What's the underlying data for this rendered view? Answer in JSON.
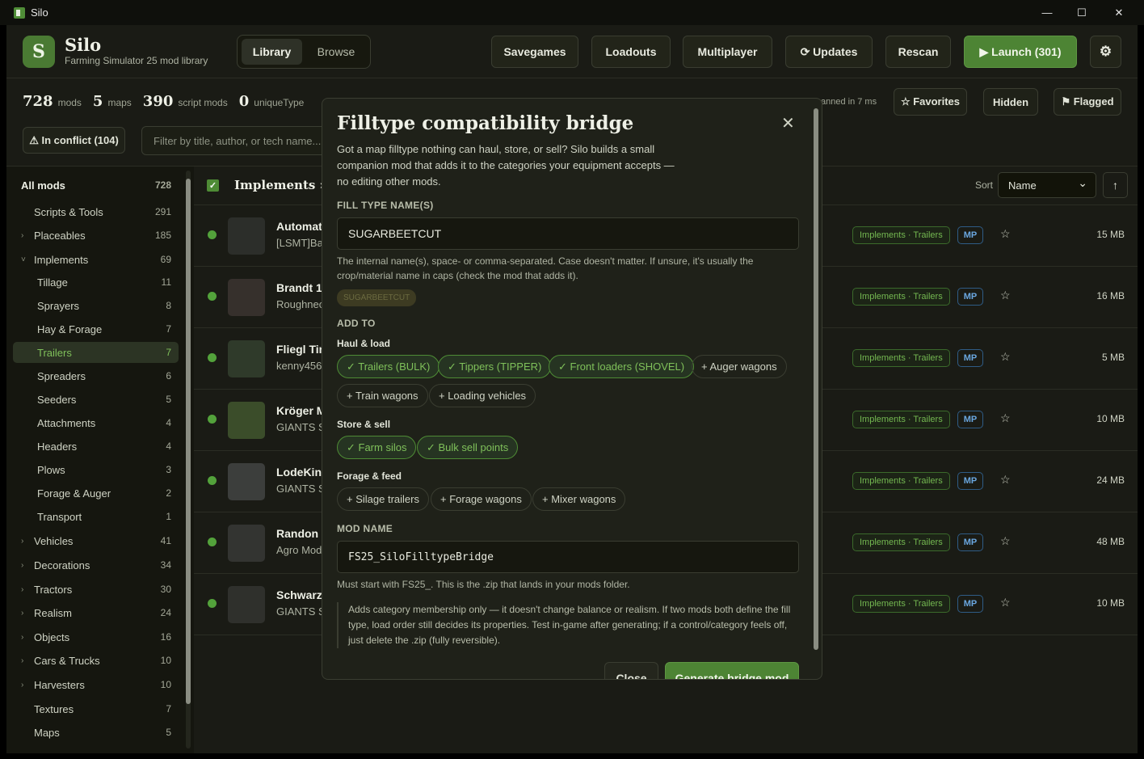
{
  "window": {
    "title": "Silo",
    "minimize": "—",
    "maximize": "☐",
    "close": "✕"
  },
  "brand": {
    "logo": "S",
    "name": "Silo",
    "tagline": "Farming Simulator 25 mod library"
  },
  "nav": {
    "library": "Library",
    "browse": "Browse"
  },
  "header_buttons": {
    "savegames": "Savegames",
    "loadouts": "Loadouts",
    "multiplayer": "Multiplayer",
    "updates": "⟳ Updates",
    "rescan": "Rescan",
    "launch": "▶ Launch (301)",
    "settings": "⚙"
  },
  "stats": {
    "mods": "728",
    "mods_label": "mods",
    "maps": "5",
    "maps_label": "maps",
    "script": "390",
    "script_label": "script mods",
    "unique": "0",
    "unique_label": "uniqueType",
    "scanned": "anned in 7 ms"
  },
  "filters": {
    "favorites": "☆ Favorites",
    "hidden": "Hidden",
    "flagged": "⚑ Flagged",
    "conflict": "⚠ In conflict (104)",
    "search_placeholder": "Filter by title, author, or tech name..."
  },
  "sidebar": {
    "all": {
      "label": "All mods",
      "count": "728"
    },
    "items": [
      {
        "label": "Scripts & Tools",
        "count": "291",
        "chev": ""
      },
      {
        "label": "Placeables",
        "count": "185",
        "chev": "›"
      },
      {
        "label": "Implements",
        "count": "69",
        "chev": "˅"
      },
      {
        "label": "Tillage",
        "count": "11",
        "chev": ""
      },
      {
        "label": "Sprayers",
        "count": "8",
        "chev": ""
      },
      {
        "label": "Hay & Forage",
        "count": "7",
        "chev": ""
      },
      {
        "label": "Trailers",
        "count": "7",
        "chev": ""
      },
      {
        "label": "Spreaders",
        "count": "6",
        "chev": ""
      },
      {
        "label": "Seeders",
        "count": "5",
        "chev": ""
      },
      {
        "label": "Attachments",
        "count": "4",
        "chev": ""
      },
      {
        "label": "Headers",
        "count": "4",
        "chev": ""
      },
      {
        "label": "Plows",
        "count": "3",
        "chev": ""
      },
      {
        "label": "Forage & Auger",
        "count": "2",
        "chev": ""
      },
      {
        "label": "Transport",
        "count": "1",
        "chev": ""
      },
      {
        "label": "Vehicles",
        "count": "41",
        "chev": "›"
      },
      {
        "label": "Decorations",
        "count": "34",
        "chev": "›"
      },
      {
        "label": "Tractors",
        "count": "30",
        "chev": "›"
      },
      {
        "label": "Realism",
        "count": "24",
        "chev": "›"
      },
      {
        "label": "Objects",
        "count": "16",
        "chev": "›"
      },
      {
        "label": "Cars & Trucks",
        "count": "10",
        "chev": "›"
      },
      {
        "label": "Harvesters",
        "count": "10",
        "chev": "›"
      },
      {
        "label": "Textures",
        "count": "7",
        "chev": ""
      },
      {
        "label": "Maps",
        "count": "5",
        "chev": ""
      }
    ]
  },
  "list": {
    "check": "✓",
    "breadcrumb": "Implements › T",
    "sort_label": "Sort",
    "sort_value": "Name",
    "sort_dir": "↑",
    "rows": [
      {
        "name": "Automat",
        "author": "[LSMT]BaT",
        "tag": "Implements · Trailers",
        "mp": "MP",
        "star": "☆",
        "size": "15 MB"
      },
      {
        "name": "Brandt 11",
        "author": "Roughnec",
        "tag": "Implements · Trailers",
        "mp": "MP",
        "star": "☆",
        "size": "16 MB"
      },
      {
        "name": "Fliegl Tin",
        "author": "kenny456,",
        "tag": "Implements · Trailers",
        "mp": "MP",
        "star": "☆",
        "size": "5 MB"
      },
      {
        "name": "Kröger M",
        "author": "GIANTS Sc",
        "tag": "Implements · Trailers",
        "mp": "MP",
        "star": "☆",
        "size": "10 MB"
      },
      {
        "name": "LodeKing",
        "author": "GIANTS Sc",
        "tag": "Implements · Trailers",
        "mp": "MP",
        "star": "☆",
        "size": "24 MB"
      },
      {
        "name": "Randon I",
        "author": "Agro Mod",
        "tag": "Implements · Trailers",
        "mp": "MP",
        "star": "☆",
        "size": "48 MB"
      },
      {
        "name": "Schwarzr",
        "author": "GIANTS Sc",
        "tag": "Implements · Trailers",
        "mp": "MP",
        "star": "☆",
        "size": "10 MB"
      }
    ]
  },
  "modal": {
    "title": "Filltype compatibility bridge",
    "close_icon": "✕",
    "intro": "Got a map filltype nothing can haul, store, or sell? Silo builds a small companion mod that adds it to the categories your equipment accepts — no editing other mods.",
    "fill_label": "FILL TYPE NAME(S)",
    "fill_value": "SUGARBEETCUT",
    "fill_help": "The internal name(s), space- or comma-separated. Case doesn't matter. If unsure, it's usually the crop/material name in caps (check the mod that adds it).",
    "fill_chip": "SUGARBEETCUT",
    "add_to": "ADD TO",
    "haul_label": "Haul & load",
    "haul": [
      "✓ Trailers (BULK)",
      "✓ Tippers (TIPPER)",
      "✓ Front loaders (SHOVEL)",
      "+ Auger wagons",
      "+ Train wagons",
      "+ Loading vehicles"
    ],
    "store_label": "Store & sell",
    "store": [
      "✓ Farm silos",
      "✓ Bulk sell points"
    ],
    "forage_label": "Forage & feed",
    "forage": [
      "+ Silage trailers",
      "+ Forage wagons",
      "+ Mixer wagons"
    ],
    "modname_label": "MOD NAME",
    "modname_value": "FS25_SiloFilltypeBridge",
    "modname_help": "Must start with FS25_. This is the .zip that lands in your mods folder.",
    "note": "Adds category membership only — it doesn't change balance or realism. If two mods both define the fill type, load order still decides its properties. Test in-game after generating; if a control/category feels off, just delete the .zip (fully reversible).",
    "btn_close": "Close",
    "btn_generate": "Generate bridge mod"
  }
}
